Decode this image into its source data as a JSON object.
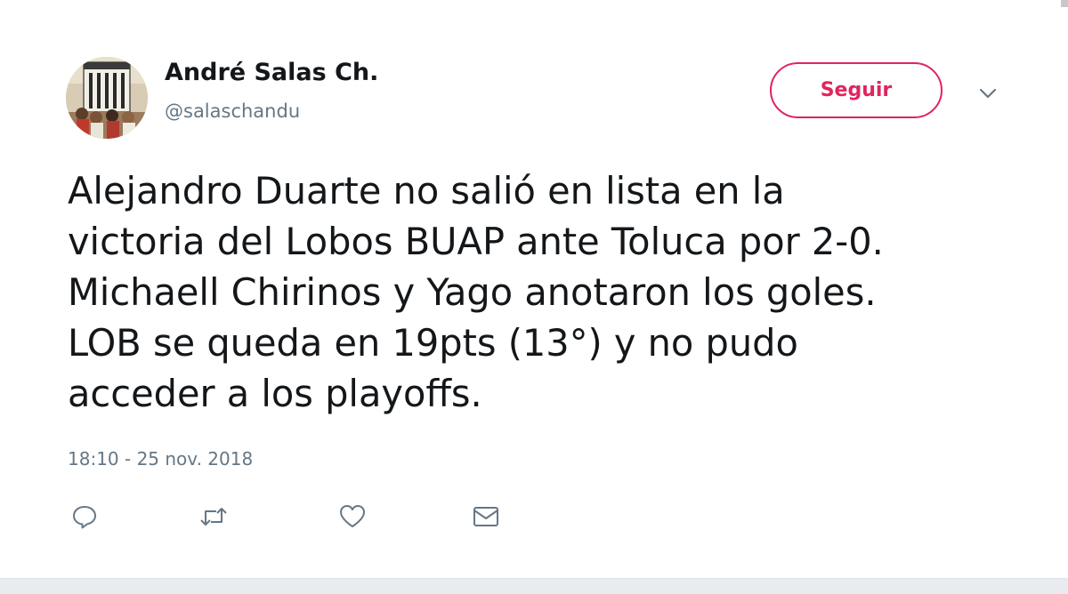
{
  "author": {
    "display_name": "André Salas Ch.",
    "handle": "@salaschandu"
  },
  "follow_button": {
    "label": "Seguir"
  },
  "tweet": {
    "lines": [
      "Alejandro Duarte no salió en lista en la",
      "victoria del Lobos BUAP ante Toluca por 2-0.",
      "Michaell Chirinos y Yago anotaron los goles.",
      "LOB se queda en 19pts (13°) y no pudo",
      "acceder a los playoffs."
    ],
    "timestamp": "18:10 - 25 nov. 2018"
  },
  "icons": {
    "avatar": "profile-photo",
    "more": "chevron-down-icon",
    "reply": "reply-icon",
    "retweet": "retweet-icon",
    "like": "heart-icon",
    "message": "envelope-icon"
  },
  "colors": {
    "follow_accent": "#e0245e",
    "text_primary": "#14171a",
    "text_secondary": "#657786"
  }
}
